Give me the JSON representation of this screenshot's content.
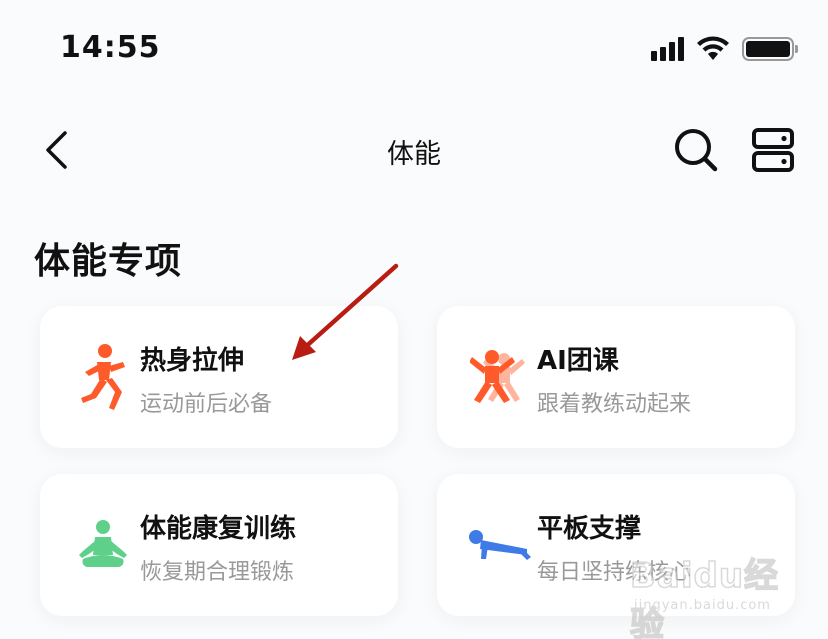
{
  "status_bar": {
    "time": "14:55"
  },
  "header": {
    "title": "体能"
  },
  "section": {
    "title": "体能专项"
  },
  "cards": [
    {
      "title": "热身拉伸",
      "subtitle": "运动前后必备",
      "icon": "running-person-icon",
      "color": "#ff5a2a"
    },
    {
      "title": "AI团课",
      "subtitle": "跟着教练动起来",
      "icon": "jumping-person-icon",
      "color": "#ff5a2a"
    },
    {
      "title": "体能康复训练",
      "subtitle": "恢复期合理锻炼",
      "icon": "meditation-person-icon",
      "color": "#5ed08a"
    },
    {
      "title": "平板支撑",
      "subtitle": "每日坚持练核心",
      "icon": "plank-person-icon",
      "color": "#3e7be6"
    }
  ],
  "annotation": {
    "color": "#b81c12"
  },
  "watermark": {
    "brand": "Baidu经验",
    "url": "jingyan.baidu.com"
  }
}
